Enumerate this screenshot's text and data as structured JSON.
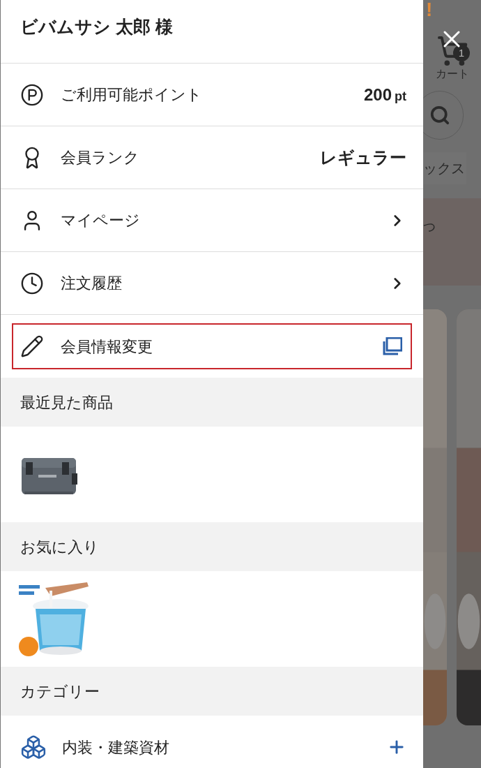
{
  "background": {
    "alert": "!",
    "cart_label": "カート",
    "cart_badge": "1",
    "tab_label": "ックス",
    "banner_text": "つ"
  },
  "drawer": {
    "user_name": "ビバムサシ 太郎 様",
    "menu": [
      {
        "kind": "value",
        "label": "ご利用可能ポイント",
        "value": "200",
        "unit": "pt",
        "highlighted": false
      },
      {
        "kind": "value",
        "label": "会員ランク",
        "value": "レギュラー",
        "highlighted": false
      },
      {
        "kind": "link",
        "label": "マイページ",
        "highlighted": false
      },
      {
        "kind": "link",
        "label": "注文履歴",
        "highlighted": false
      },
      {
        "kind": "external",
        "label": "会員情報変更",
        "highlighted": true
      }
    ],
    "sections": [
      {
        "title": "最近見た商品"
      },
      {
        "title": "お気に入り"
      },
      {
        "title": "カテゴリー",
        "categories": [
          {
            "label": "内装・建築資材",
            "expanded": false
          }
        ]
      }
    ]
  }
}
